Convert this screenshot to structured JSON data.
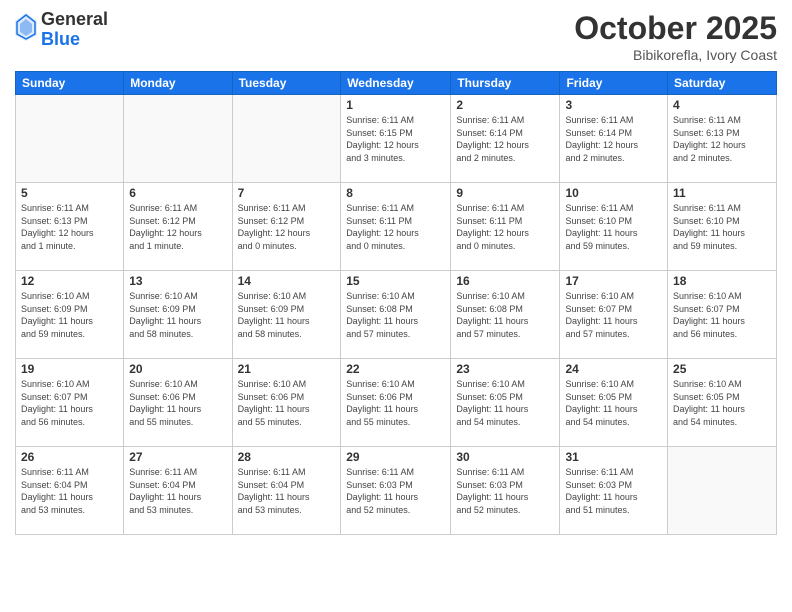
{
  "header": {
    "logo": {
      "line1": "General",
      "line2": "Blue"
    },
    "title": "October 2025",
    "subtitle": "Bibikorefla, Ivory Coast"
  },
  "days_of_week": [
    "Sunday",
    "Monday",
    "Tuesday",
    "Wednesday",
    "Thursday",
    "Friday",
    "Saturday"
  ],
  "weeks": [
    [
      {
        "day": "",
        "info": ""
      },
      {
        "day": "",
        "info": ""
      },
      {
        "day": "",
        "info": ""
      },
      {
        "day": "1",
        "info": "Sunrise: 6:11 AM\nSunset: 6:15 PM\nDaylight: 12 hours\nand 3 minutes."
      },
      {
        "day": "2",
        "info": "Sunrise: 6:11 AM\nSunset: 6:14 PM\nDaylight: 12 hours\nand 2 minutes."
      },
      {
        "day": "3",
        "info": "Sunrise: 6:11 AM\nSunset: 6:14 PM\nDaylight: 12 hours\nand 2 minutes."
      },
      {
        "day": "4",
        "info": "Sunrise: 6:11 AM\nSunset: 6:13 PM\nDaylight: 12 hours\nand 2 minutes."
      }
    ],
    [
      {
        "day": "5",
        "info": "Sunrise: 6:11 AM\nSunset: 6:13 PM\nDaylight: 12 hours\nand 1 minute."
      },
      {
        "day": "6",
        "info": "Sunrise: 6:11 AM\nSunset: 6:12 PM\nDaylight: 12 hours\nand 1 minute."
      },
      {
        "day": "7",
        "info": "Sunrise: 6:11 AM\nSunset: 6:12 PM\nDaylight: 12 hours\nand 0 minutes."
      },
      {
        "day": "8",
        "info": "Sunrise: 6:11 AM\nSunset: 6:11 PM\nDaylight: 12 hours\nand 0 minutes."
      },
      {
        "day": "9",
        "info": "Sunrise: 6:11 AM\nSunset: 6:11 PM\nDaylight: 12 hours\nand 0 minutes."
      },
      {
        "day": "10",
        "info": "Sunrise: 6:11 AM\nSunset: 6:10 PM\nDaylight: 11 hours\nand 59 minutes."
      },
      {
        "day": "11",
        "info": "Sunrise: 6:11 AM\nSunset: 6:10 PM\nDaylight: 11 hours\nand 59 minutes."
      }
    ],
    [
      {
        "day": "12",
        "info": "Sunrise: 6:10 AM\nSunset: 6:09 PM\nDaylight: 11 hours\nand 59 minutes."
      },
      {
        "day": "13",
        "info": "Sunrise: 6:10 AM\nSunset: 6:09 PM\nDaylight: 11 hours\nand 58 minutes."
      },
      {
        "day": "14",
        "info": "Sunrise: 6:10 AM\nSunset: 6:09 PM\nDaylight: 11 hours\nand 58 minutes."
      },
      {
        "day": "15",
        "info": "Sunrise: 6:10 AM\nSunset: 6:08 PM\nDaylight: 11 hours\nand 57 minutes."
      },
      {
        "day": "16",
        "info": "Sunrise: 6:10 AM\nSunset: 6:08 PM\nDaylight: 11 hours\nand 57 minutes."
      },
      {
        "day": "17",
        "info": "Sunrise: 6:10 AM\nSunset: 6:07 PM\nDaylight: 11 hours\nand 57 minutes."
      },
      {
        "day": "18",
        "info": "Sunrise: 6:10 AM\nSunset: 6:07 PM\nDaylight: 11 hours\nand 56 minutes."
      }
    ],
    [
      {
        "day": "19",
        "info": "Sunrise: 6:10 AM\nSunset: 6:07 PM\nDaylight: 11 hours\nand 56 minutes."
      },
      {
        "day": "20",
        "info": "Sunrise: 6:10 AM\nSunset: 6:06 PM\nDaylight: 11 hours\nand 55 minutes."
      },
      {
        "day": "21",
        "info": "Sunrise: 6:10 AM\nSunset: 6:06 PM\nDaylight: 11 hours\nand 55 minutes."
      },
      {
        "day": "22",
        "info": "Sunrise: 6:10 AM\nSunset: 6:06 PM\nDaylight: 11 hours\nand 55 minutes."
      },
      {
        "day": "23",
        "info": "Sunrise: 6:10 AM\nSunset: 6:05 PM\nDaylight: 11 hours\nand 54 minutes."
      },
      {
        "day": "24",
        "info": "Sunrise: 6:10 AM\nSunset: 6:05 PM\nDaylight: 11 hours\nand 54 minutes."
      },
      {
        "day": "25",
        "info": "Sunrise: 6:10 AM\nSunset: 6:05 PM\nDaylight: 11 hours\nand 54 minutes."
      }
    ],
    [
      {
        "day": "26",
        "info": "Sunrise: 6:11 AM\nSunset: 6:04 PM\nDaylight: 11 hours\nand 53 minutes."
      },
      {
        "day": "27",
        "info": "Sunrise: 6:11 AM\nSunset: 6:04 PM\nDaylight: 11 hours\nand 53 minutes."
      },
      {
        "day": "28",
        "info": "Sunrise: 6:11 AM\nSunset: 6:04 PM\nDaylight: 11 hours\nand 53 minutes."
      },
      {
        "day": "29",
        "info": "Sunrise: 6:11 AM\nSunset: 6:03 PM\nDaylight: 11 hours\nand 52 minutes."
      },
      {
        "day": "30",
        "info": "Sunrise: 6:11 AM\nSunset: 6:03 PM\nDaylight: 11 hours\nand 52 minutes."
      },
      {
        "day": "31",
        "info": "Sunrise: 6:11 AM\nSunset: 6:03 PM\nDaylight: 11 hours\nand 51 minutes."
      },
      {
        "day": "",
        "info": ""
      }
    ]
  ]
}
